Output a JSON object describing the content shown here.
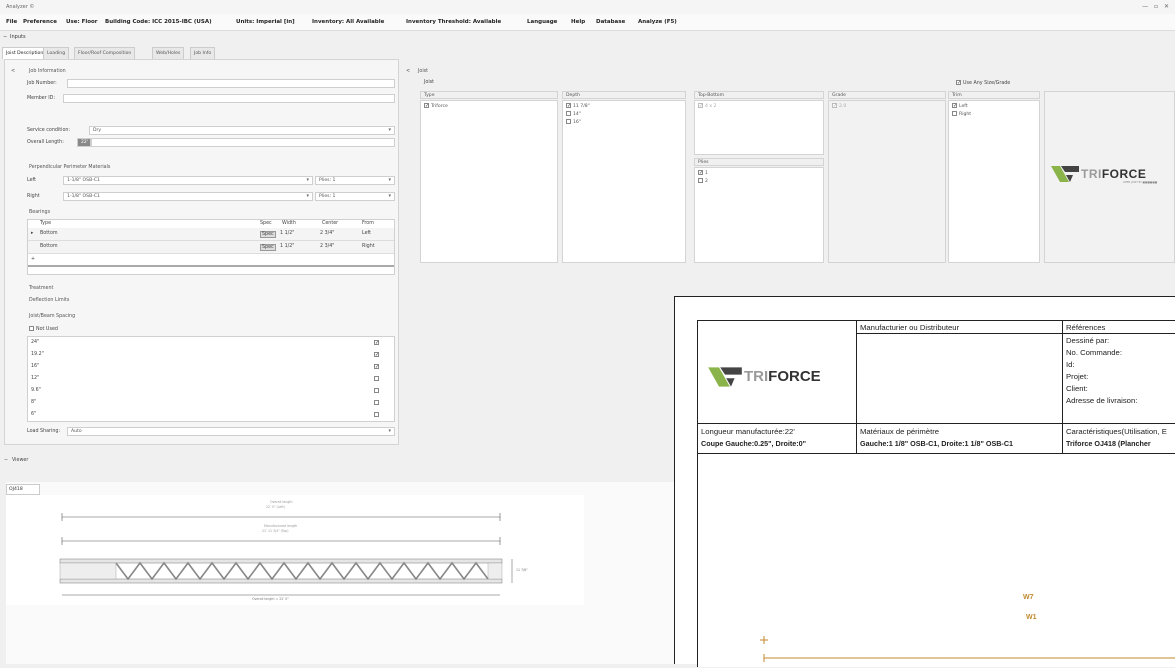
{
  "window": {
    "title": "Analyzer ©",
    "controls": "— ▫ ✕"
  },
  "menu": [
    "File",
    "Preference",
    "Use: Floor",
    "Building Code: ICC 2015-IBC (USA)",
    "Units: Imperial [in]",
    "Inventory: All Available",
    "Inventory Threshold: Available",
    "Language",
    "Help",
    "Database",
    "Analyze (F5)"
  ],
  "inputs_label": "Inputs",
  "tabs": [
    "Joist Description",
    "Loading",
    "Floor/Roof Composition",
    "Web/Holes",
    "Job Info"
  ],
  "job": {
    "section": "Job Information",
    "job_number_label": "Job Number:",
    "member_id_label": "Member ID:",
    "overall_length_label": "Overall Length:",
    "overall_length_value": "22'",
    "service_condition_label": "Service condition:",
    "service_condition_value": "Dry"
  },
  "perimeter": {
    "section": "Perpendicular Perimeter Materials",
    "left_label": "Left",
    "left_value": "1-1/8\" OSB-C1",
    "left_plies": "Plies: 1",
    "right_label": "Right",
    "right_value": "1-1/8\" OSB-C1",
    "right_plies": "Plies: 1"
  },
  "bearings": {
    "section": "Bearings",
    "headers": [
      "Type",
      "Spec",
      "Width",
      "Center",
      "From"
    ],
    "rows": [
      {
        "type": "Bottom",
        "spec": "Spec",
        "width": "1 1/2\"",
        "center": "2 3/4\"",
        "from": "Left"
      },
      {
        "type": "Bottom",
        "spec": "Spec",
        "width": "1 1/2\"",
        "center": "2 3/4\"",
        "from": "Right"
      }
    ]
  },
  "treatment": "Treatment",
  "deflection": "Deflection Limits",
  "spacing": {
    "section": "Joist/Beam Spacing",
    "not_used": "Not Used",
    "items": [
      {
        "label": "24\"",
        "checked": true
      },
      {
        "label": "19.2\"",
        "checked": true
      },
      {
        "label": "16\"",
        "checked": true
      },
      {
        "label": "12\"",
        "checked": false
      },
      {
        "label": "9.6\"",
        "checked": false
      },
      {
        "label": "8\"",
        "checked": false
      },
      {
        "label": "6\"",
        "checked": false
      }
    ]
  },
  "load_sharing": {
    "label": "Load Sharing:",
    "value": "Auto"
  },
  "joist": {
    "section": "Joist",
    "sub": "Joist",
    "use_any": "Use Any Size/Grade",
    "type_hdr": "Type",
    "type_opt": "Triforce",
    "depth_hdr": "Depth",
    "depth_opts": [
      {
        "label": "11 7/8\"",
        "checked": true
      },
      {
        "label": "14\"",
        "checked": false
      },
      {
        "label": "16\"",
        "checked": false
      }
    ],
    "topbottom_hdr": "Top-Bottom",
    "topbottom_opt": "4 x 2",
    "grade_hdr": "Grade",
    "grade_opt": "2.0",
    "trim_hdr": "Trim",
    "trim_opts": [
      {
        "label": "Left",
        "checked": true
      },
      {
        "label": "Right",
        "checked": false
      }
    ],
    "plies_hdr": "Plies",
    "plies_opts": [
      {
        "label": "1",
        "checked": true
      },
      {
        "label": "2",
        "checked": false
      }
    ],
    "logo": "TRIFORCE",
    "logo_tag": "OPEN JOIST BY ■■■■■■"
  },
  "viewer": {
    "label": "Viewer",
    "tab": "OJ418"
  },
  "drawing": {
    "dim_top": "Overall length",
    "dim_top2": "22' 0\" (Left)",
    "dim_mid": "Manufactured length",
    "dim_mid2": "21' 11 3/4\" (Top)",
    "depth": "11 7/8\"",
    "bottom": "Overall length = 22' 0\""
  },
  "report": {
    "manufacturer_hdr": "Manufacturier ou Distributeur",
    "references_hdr": "Références",
    "ref_lines": [
      "Dessiné par:",
      "No. Commande:",
      "Id:",
      "Projet:",
      "Client:",
      "Adresse de livraison:"
    ],
    "logo": "TRIFORCE",
    "length_line": "Longueur manufacturée:22'",
    "cut_line": "Coupe Gauche:0.25\", Droite:0\"",
    "materials_hdr": "Matériaux de périmètre",
    "materials_value": "Gauche:1 1/8\" OSB-C1, Droite:1 1/8\" OSB-C1",
    "charac_hdr": "Caractéristiques(Utilisation, E",
    "charac_value": "Triforce OJ418 (Plancher",
    "w7": "W7",
    "w1": "W1"
  },
  "colors": {
    "accent": "#8ab34a",
    "logo_dark": "#333333",
    "wood": "#c08a2e"
  }
}
